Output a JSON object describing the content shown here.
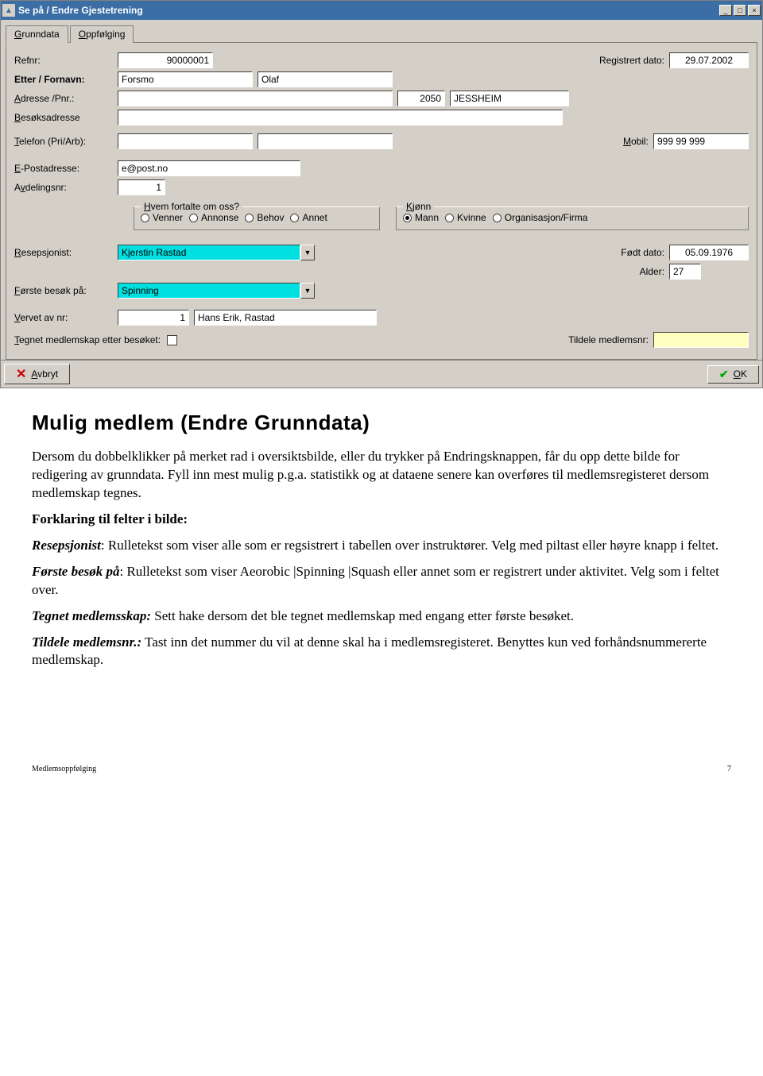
{
  "window": {
    "title": "Se på / Endre Gjestetrening"
  },
  "tabs": {
    "active": "Grunndata",
    "other": "Oppfølging"
  },
  "labels": {
    "refnr": "Refnr:",
    "regdato": "Registrert dato:",
    "navn": "Etter / Fornavn:",
    "adresse": "Adresse /Pnr.:",
    "besok": "Besøksadresse",
    "telefon": "Telefon (Pri/Arb):",
    "mobil": "Mobil:",
    "epost": "E-Postadresse:",
    "avd": "Avdelingsnr:",
    "hvem": "Hvem fortalte om oss?",
    "kjonn": "Kjønn",
    "resepsjonist": "Resepsjonist:",
    "fodt": "Født dato:",
    "alder": "Alder:",
    "forste": "Første besøk på:",
    "vervet": "Vervet av nr:",
    "tegnet": "Tegnet medlemskap etter besøket:",
    "tildele": "Tildele medlemsnr:",
    "avbryt": "Avbryt",
    "ok": "OK"
  },
  "radios_hvem": {
    "a": "Venner",
    "b": "Annonse",
    "c": "Behov",
    "d": "Annet"
  },
  "radios_kjonn": {
    "a": "Mann",
    "b": "Kvinne",
    "c": "Organisasjon/Firma"
  },
  "values": {
    "refnr": "90000001",
    "regdato": "29.07.2002",
    "etternavn": "Forsmo",
    "fornavn": "Olaf",
    "postnr": "2050",
    "poststed": "JESSHEIM",
    "mobil": "999 99 999",
    "epost": "e@post.no",
    "avd": "1",
    "resepsjonist": "Kjerstin Rastad",
    "fodt": "05.09.1976",
    "alder": "27",
    "forste": "Spinning",
    "vervet_nr": "1",
    "vervet_navn": "Hans Erik, Rastad"
  },
  "doc": {
    "h1": "Mulig medlem (Endre Grunndata)",
    "p1": "Dersom du dobbelklikker på merket rad i oversiktsbilde, eller du trykker på Endringsknappen, får du opp dette bilde for redigering av grunndata. Fyll inn mest mulig p.g.a. statistikk og at dataene senere kan overføres til medlemsregisteret dersom medlemskap tegnes.",
    "p2": "Forklaring til felter i bilde:",
    "t1": "Resepsjonist",
    "p3": ":  Rulletekst som viser alle som er regsistrert i tabellen over instruktører. Velg med piltast eller høyre knapp i feltet.",
    "t2": "Første besøk på",
    "p4": ":  Rulletekst som viser Aeorobic |Spinning |Squash eller annet som er registrert under aktivitet. Velg som i feltet over.",
    "t3": "Tegnet medlemsskap:",
    "p5": " Sett hake dersom det ble tegnet medlemskap med engang etter første besøket.",
    "t4": "Tildele medlemsnr.:",
    "p6": " Tast inn det nummer du vil at denne skal ha i medlemsregisteret. Benyttes kun ved forhåndsnummererte medlemskap.",
    "footer_l": "Medlemsoppfølging",
    "footer_r": "7"
  }
}
